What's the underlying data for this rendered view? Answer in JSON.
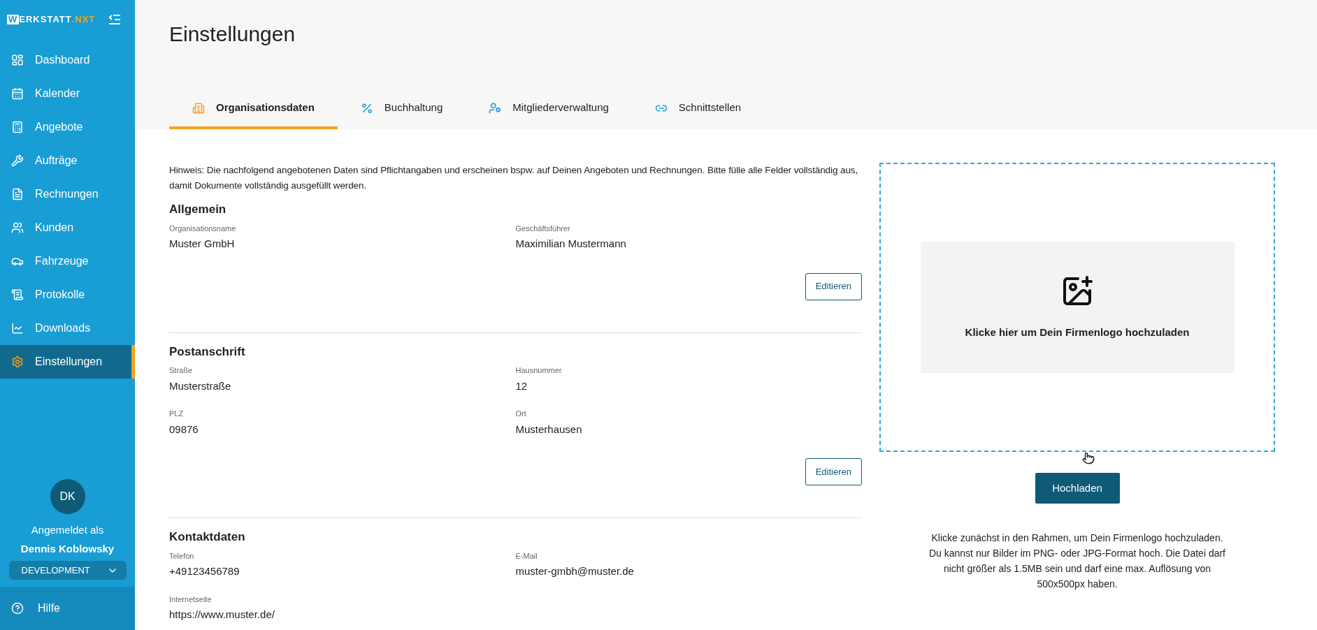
{
  "logo": {
    "boxed": "W",
    "main": "ERKSTATT",
    "accent": ".NXT"
  },
  "sidebar": {
    "items": [
      {
        "label": "Dashboard",
        "selected": false
      },
      {
        "label": "Kalender",
        "selected": false
      },
      {
        "label": "Angebote",
        "selected": false
      },
      {
        "label": "Aufträge",
        "selected": false
      },
      {
        "label": "Rechnungen",
        "selected": false
      },
      {
        "label": "Kunden",
        "selected": false
      },
      {
        "label": "Fahrzeuge",
        "selected": false
      },
      {
        "label": "Protokolle",
        "selected": false
      },
      {
        "label": "Downloads",
        "selected": false
      },
      {
        "label": "Einstellungen",
        "selected": true
      }
    ],
    "user": {
      "initials": "DK",
      "caption": "Angemeldet als",
      "name": "Dennis Koblowsky",
      "environment": "DEVELOPMENT"
    },
    "help": "Hilfe"
  },
  "page": {
    "title": "Einstellungen"
  },
  "tabs": [
    {
      "label": "Organisationsdaten",
      "selected": true
    },
    {
      "label": "Buchhaltung",
      "selected": false
    },
    {
      "label": "Mitgliederverwaltung",
      "selected": false
    },
    {
      "label": "Schnittstellen",
      "selected": false
    }
  ],
  "notice": "Hinweis: Die nachfolgend angebotenen Daten sind Pflichtangaben und erscheinen bspw. auf Deinen Angeboten und Rechnungen. Bitte fülle alle Felder vollständig aus, damit Dokumente vollständig ausgefüllt werden.",
  "sections": [
    {
      "title": "Allgemein",
      "fields": [
        {
          "label": "Organisationsname",
          "value": "Muster GmbH"
        },
        {
          "label": "Geschäftsführer",
          "value": "Maximilian Mustermann"
        }
      ],
      "button": "Editieren"
    },
    {
      "title": "Postanschrift",
      "fields": [
        {
          "label": "Straße",
          "value": "Musterstraße"
        },
        {
          "label": "Hausnummer",
          "value": "12"
        },
        {
          "label": "PLZ",
          "value": "09876"
        },
        {
          "label": "Ort",
          "value": "Musterhausen"
        }
      ],
      "button": "Editieren"
    },
    {
      "title": "Kontaktdaten",
      "fields": [
        {
          "label": "Telefon",
          "value": "+49123456789"
        },
        {
          "label": "E-Mail",
          "value": "muster-gmbh@muster.de"
        },
        {
          "label": "Internetseite",
          "value": "https://www.muster.de/"
        }
      ]
    }
  ],
  "upload": {
    "prompt": "Klicke hier um Dein Firmenlogo hochzuladen",
    "button": "Hochladen",
    "info": "Klicke zunächst in den Rahmen, um Dein Firmenlogo hochzuladen. Du kannst nur Bilder im PNG- oder JPG-Format hoch. Die Datei darf nicht größer als 1.5MB sein und darf eine max. Auflösung von 500x500px haben."
  }
}
